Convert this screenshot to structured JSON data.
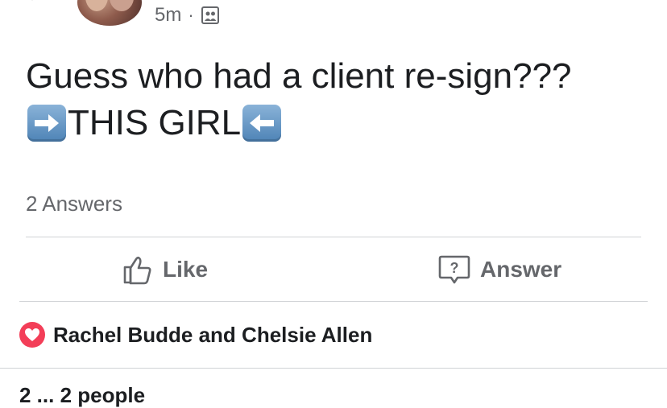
{
  "post": {
    "timestamp": "5m",
    "separator": "·",
    "text_line1": "Guess who had a client re-sign???",
    "text_line2": "THIS GIRL",
    "answers_count": "2 Answers"
  },
  "actions": {
    "like_label": "Like",
    "answer_label": "Answer"
  },
  "reactions": {
    "names": "Rachel Budde and Chelsie Allen",
    "icon": "heart-icon"
  },
  "footer": {
    "partial_text": "2 ... 2 people"
  },
  "colors": {
    "secondary_text": "#65676b",
    "primary_text": "#1c1e21",
    "heart": "#f33e58",
    "divider": "#d0d2d6"
  }
}
